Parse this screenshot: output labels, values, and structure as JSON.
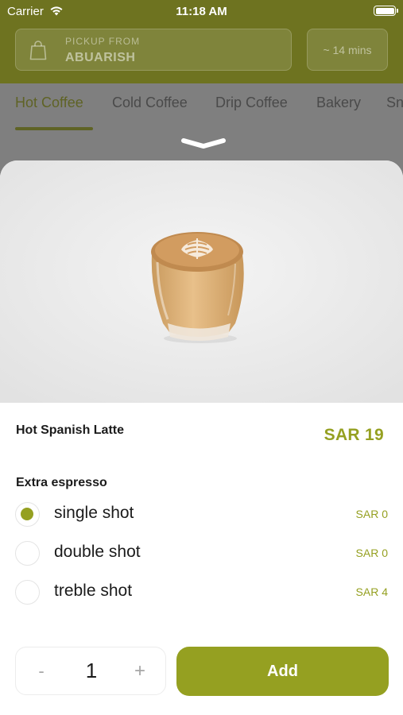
{
  "status_bar": {
    "carrier": "Carrier",
    "time": "11:18 AM"
  },
  "header": {
    "pickup_label": "PICKUP FROM",
    "pickup_location": "ABUARISH",
    "eta": "~ 14 mins"
  },
  "category_tabs": [
    {
      "label": "Hot Coffee",
      "active": true
    },
    {
      "label": "Cold Coffee",
      "active": false
    },
    {
      "label": "Drip Coffee",
      "active": false
    },
    {
      "label": "Bakery",
      "active": false
    },
    {
      "label": "Snacks",
      "active": false
    }
  ],
  "product": {
    "name": "Hot Spanish Latte",
    "price": "SAR 19",
    "image_icon": "latte-cup-photo"
  },
  "options": {
    "title": "Extra espresso",
    "items": [
      {
        "label": "single shot",
        "price": "SAR 0",
        "selected": true
      },
      {
        "label": "double shot",
        "price": "SAR 0",
        "selected": false
      },
      {
        "label": "treble shot",
        "price": "SAR 4",
        "selected": false
      }
    ]
  },
  "quantity": {
    "minus": "-",
    "value": "1",
    "plus": "+"
  },
  "add_button": {
    "label": "Add"
  },
  "colors": {
    "brand": "#95a021",
    "header_bg": "#6e7320",
    "overlay": "#7f7f7f"
  }
}
